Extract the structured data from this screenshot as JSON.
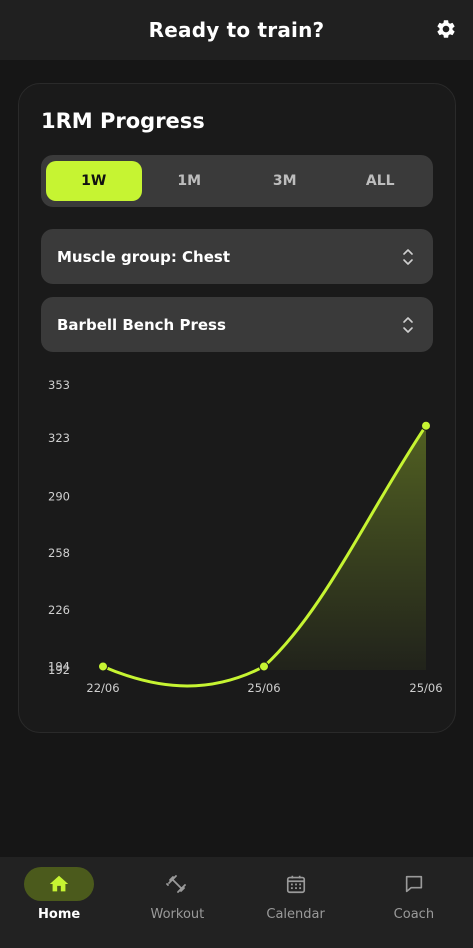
{
  "header": {
    "title": "Ready to train?",
    "settings_icon": "gear-icon"
  },
  "card": {
    "title": "1RM Progress",
    "ranges": [
      {
        "label": "1W",
        "active": true
      },
      {
        "label": "1M",
        "active": false
      },
      {
        "label": "3M",
        "active": false
      },
      {
        "label": "ALL",
        "active": false
      }
    ],
    "muscle_select": "Muscle group: Chest",
    "exercise_select": "Barbell Bench Press"
  },
  "chart_data": {
    "type": "area",
    "title": "",
    "xlabel": "",
    "ylabel": "",
    "x": [
      "22/06",
      "25/06",
      "25/06"
    ],
    "values": [
      194,
      194,
      330
    ],
    "yticks": [
      194,
      192,
      226,
      258,
      290,
      323,
      353
    ],
    "ylim": [
      192,
      353
    ],
    "line_color": "#c6f432",
    "grid": false
  },
  "nav": {
    "items": [
      {
        "label": "Home",
        "icon": "home-icon",
        "active": true
      },
      {
        "label": "Workout",
        "icon": "dumbbell-icon",
        "active": false
      },
      {
        "label": "Calendar",
        "icon": "calendar-icon",
        "active": false
      },
      {
        "label": "Coach",
        "icon": "chat-icon",
        "active": false
      }
    ]
  }
}
